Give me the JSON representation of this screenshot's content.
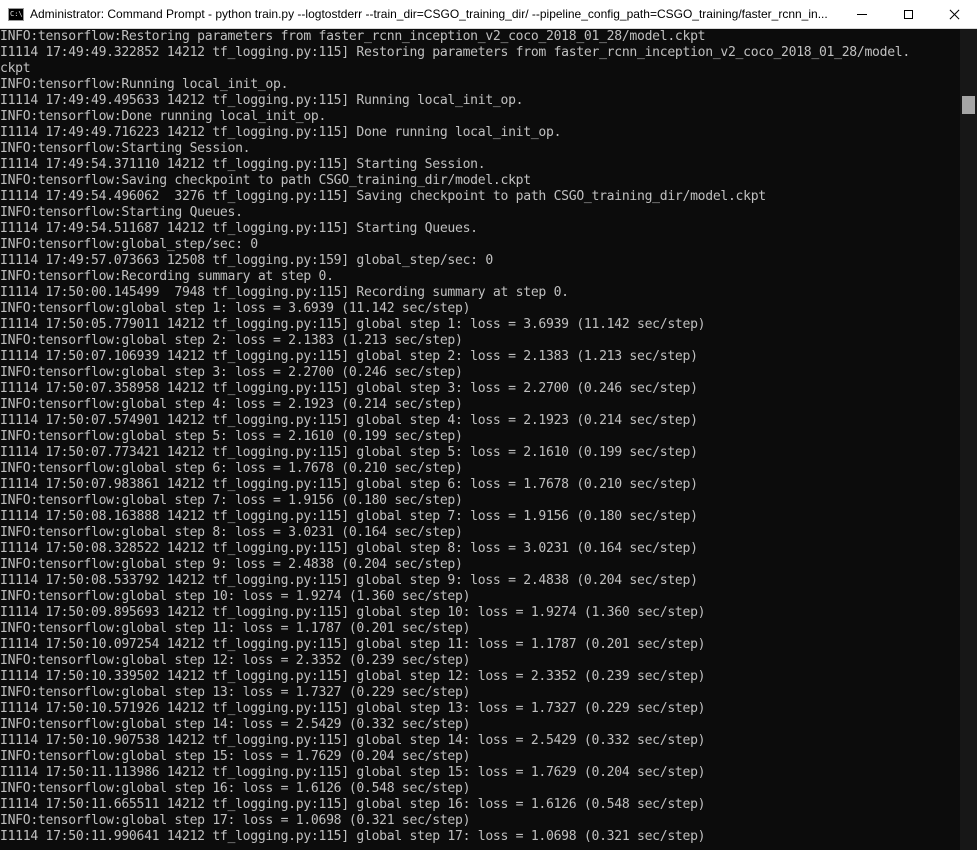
{
  "window": {
    "title": "Administrator: Command Prompt - python  train.py --logtostderr --train_dir=CSGO_training_dir/ --pipeline_config_path=CSGO_training/faster_rcnn_in...",
    "icon_glyph": "C:\\",
    "icon": "console-icon",
    "buttons": {
      "minimize": "minimize-icon",
      "maximize": "maximize-icon",
      "close": "close-icon"
    }
  },
  "colors": {
    "background": "#0c0c0c",
    "text": "#c0c0c0",
    "titlebar": "#ffffff"
  },
  "console": {
    "lines": [
      "INFO:tensorflow:Restoring parameters from faster_rcnn_inception_v2_coco_2018_01_28/model.ckpt",
      "I1114 17:49:49.322852 14212 tf_logging.py:115] Restoring parameters from faster_rcnn_inception_v2_coco_2018_01_28/model.",
      "ckpt",
      "INFO:tensorflow:Running local_init_op.",
      "I1114 17:49:49.495633 14212 tf_logging.py:115] Running local_init_op.",
      "INFO:tensorflow:Done running local_init_op.",
      "I1114 17:49:49.716223 14212 tf_logging.py:115] Done running local_init_op.",
      "INFO:tensorflow:Starting Session.",
      "I1114 17:49:54.371110 14212 tf_logging.py:115] Starting Session.",
      "INFO:tensorflow:Saving checkpoint to path CSGO_training_dir/model.ckpt",
      "I1114 17:49:54.496062  3276 tf_logging.py:115] Saving checkpoint to path CSGO_training_dir/model.ckpt",
      "INFO:tensorflow:Starting Queues.",
      "I1114 17:49:54.511687 14212 tf_logging.py:115] Starting Queues.",
      "INFO:tensorflow:global_step/sec: 0",
      "I1114 17:49:57.073663 12508 tf_logging.py:159] global_step/sec: 0",
      "INFO:tensorflow:Recording summary at step 0.",
      "I1114 17:50:00.145499  7948 tf_logging.py:115] Recording summary at step 0.",
      "INFO:tensorflow:global step 1: loss = 3.6939 (11.142 sec/step)",
      "I1114 17:50:05.779011 14212 tf_logging.py:115] global step 1: loss = 3.6939 (11.142 sec/step)",
      "INFO:tensorflow:global step 2: loss = 2.1383 (1.213 sec/step)",
      "I1114 17:50:07.106939 14212 tf_logging.py:115] global step 2: loss = 2.1383 (1.213 sec/step)",
      "INFO:tensorflow:global step 3: loss = 2.2700 (0.246 sec/step)",
      "I1114 17:50:07.358958 14212 tf_logging.py:115] global step 3: loss = 2.2700 (0.246 sec/step)",
      "INFO:tensorflow:global step 4: loss = 2.1923 (0.214 sec/step)",
      "I1114 17:50:07.574901 14212 tf_logging.py:115] global step 4: loss = 2.1923 (0.214 sec/step)",
      "INFO:tensorflow:global step 5: loss = 2.1610 (0.199 sec/step)",
      "I1114 17:50:07.773421 14212 tf_logging.py:115] global step 5: loss = 2.1610 (0.199 sec/step)",
      "INFO:tensorflow:global step 6: loss = 1.7678 (0.210 sec/step)",
      "I1114 17:50:07.983861 14212 tf_logging.py:115] global step 6: loss = 1.7678 (0.210 sec/step)",
      "INFO:tensorflow:global step 7: loss = 1.9156 (0.180 sec/step)",
      "I1114 17:50:08.163888 14212 tf_logging.py:115] global step 7: loss = 1.9156 (0.180 sec/step)",
      "INFO:tensorflow:global step 8: loss = 3.0231 (0.164 sec/step)",
      "I1114 17:50:08.328522 14212 tf_logging.py:115] global step 8: loss = 3.0231 (0.164 sec/step)",
      "INFO:tensorflow:global step 9: loss = 2.4838 (0.204 sec/step)",
      "I1114 17:50:08.533792 14212 tf_logging.py:115] global step 9: loss = 2.4838 (0.204 sec/step)",
      "INFO:tensorflow:global step 10: loss = 1.9274 (1.360 sec/step)",
      "I1114 17:50:09.895693 14212 tf_logging.py:115] global step 10: loss = 1.9274 (1.360 sec/step)",
      "INFO:tensorflow:global step 11: loss = 1.1787 (0.201 sec/step)",
      "I1114 17:50:10.097254 14212 tf_logging.py:115] global step 11: loss = 1.1787 (0.201 sec/step)",
      "INFO:tensorflow:global step 12: loss = 2.3352 (0.239 sec/step)",
      "I1114 17:50:10.339502 14212 tf_logging.py:115] global step 12: loss = 2.3352 (0.239 sec/step)",
      "INFO:tensorflow:global step 13: loss = 1.7327 (0.229 sec/step)",
      "I1114 17:50:10.571926 14212 tf_logging.py:115] global step 13: loss = 1.7327 (0.229 sec/step)",
      "INFO:tensorflow:global step 14: loss = 2.5429 (0.332 sec/step)",
      "I1114 17:50:10.907538 14212 tf_logging.py:115] global step 14: loss = 2.5429 (0.332 sec/step)",
      "INFO:tensorflow:global step 15: loss = 1.7629 (0.204 sec/step)",
      "I1114 17:50:11.113986 14212 tf_logging.py:115] global step 15: loss = 1.7629 (0.204 sec/step)",
      "INFO:tensorflow:global step 16: loss = 1.6126 (0.548 sec/step)",
      "I1114 17:50:11.665511 14212 tf_logging.py:115] global step 16: loss = 1.6126 (0.548 sec/step)",
      "INFO:tensorflow:global step 17: loss = 1.0698 (0.321 sec/step)",
      "I1114 17:50:11.990641 14212 tf_logging.py:115] global step 17: loss = 1.0698 (0.321 sec/step)"
    ]
  }
}
